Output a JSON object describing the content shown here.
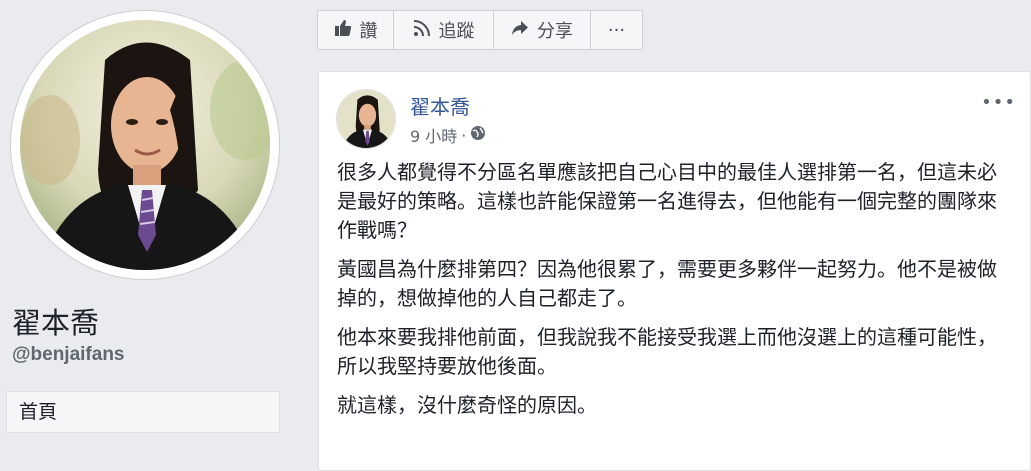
{
  "profile": {
    "name": "翟本喬",
    "handle": "@benjaifans",
    "nav_home": "首頁"
  },
  "actions": {
    "like_label": "讚",
    "follow_label": "追蹤",
    "share_label": "分享",
    "more_label": "···"
  },
  "post": {
    "author": "翟本喬",
    "time": "9 小時",
    "separator": "·",
    "options_label": "•••",
    "paragraphs": [
      "很多人都覺得不分區名單應該把自己心目中的最佳人選排第一名，但這未必是最好的策略。這樣也許能保證第一名進得去，但他能有一個完整的團隊來作戰嗎？",
      "黃國昌為什麼排第四？因為他很累了，需要更多夥伴一起努力。他不是被做掉的，想做掉他的人自己都走了。",
      "他本來要我排他前面，但我說我不能接受我選上而他沒選上的這種可能性，所以我堅持要放他後面。",
      "就這樣，沒什麼奇怪的原因。"
    ]
  },
  "icons": {
    "like": "thumbs-up-icon",
    "follow": "rss-icon",
    "share": "share-arrow-icon",
    "privacy": "globe-icon"
  },
  "colors": {
    "background": "#e9ebee",
    "link": "#365899",
    "text": "#1d2129",
    "muted": "#616770"
  }
}
